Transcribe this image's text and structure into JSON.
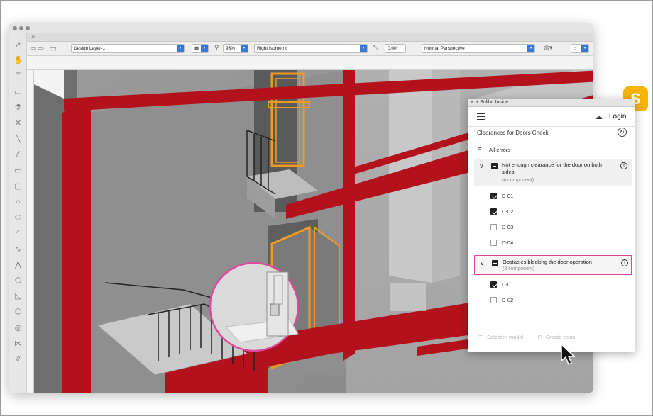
{
  "window": {
    "tab_close": "×"
  },
  "toolbar": {
    "layer_select": "Design Layer-1",
    "zoom_value": "93%",
    "view_select": "Right Isometric",
    "angle_value": "0.00°",
    "perspective_select": "Normal Perspective"
  },
  "tools": [
    "pointer-icon",
    "pan-icon",
    "text-icon",
    "callout-icon",
    "attribute-icon",
    "cross-icon",
    "line-icon",
    "double-line-icon",
    "rectangle-icon",
    "rounded-rect-icon",
    "circle-icon",
    "oval-icon",
    "arc-icon",
    "freehand-icon",
    "polyline-icon",
    "polygon-icon",
    "triangle-icon",
    "hexagon-icon",
    "spiral-icon",
    "bowtie-icon",
    "wall-icon"
  ],
  "panel": {
    "title": "Solibri Inside",
    "login_label": "Login",
    "check_title": "Clearances for Doors Check",
    "filter_label": "All errors",
    "groups": [
      {
        "title": "Not enough clearance for the door on both sides",
        "subtitle": "(4 component)",
        "items": [
          {
            "label": "D-01",
            "checked": true
          },
          {
            "label": "D-02",
            "checked": true
          },
          {
            "label": "D-03",
            "checked": false
          },
          {
            "label": "D-04",
            "checked": false
          }
        ]
      },
      {
        "title": "Obstacles blocking the door operation",
        "subtitle": "(2 component)",
        "items": [
          {
            "label": "D-01",
            "checked": true
          },
          {
            "label": "D-02",
            "checked": false
          }
        ]
      }
    ],
    "footer": {
      "select_label": "Select in model",
      "issue_label": "Create issue"
    }
  },
  "logo": {
    "letter": "S",
    "color": "#f5b400"
  },
  "colors": {
    "highlight": "#e0479c",
    "frame_red": "#b3121c",
    "door_orange": "#f09a1e"
  }
}
